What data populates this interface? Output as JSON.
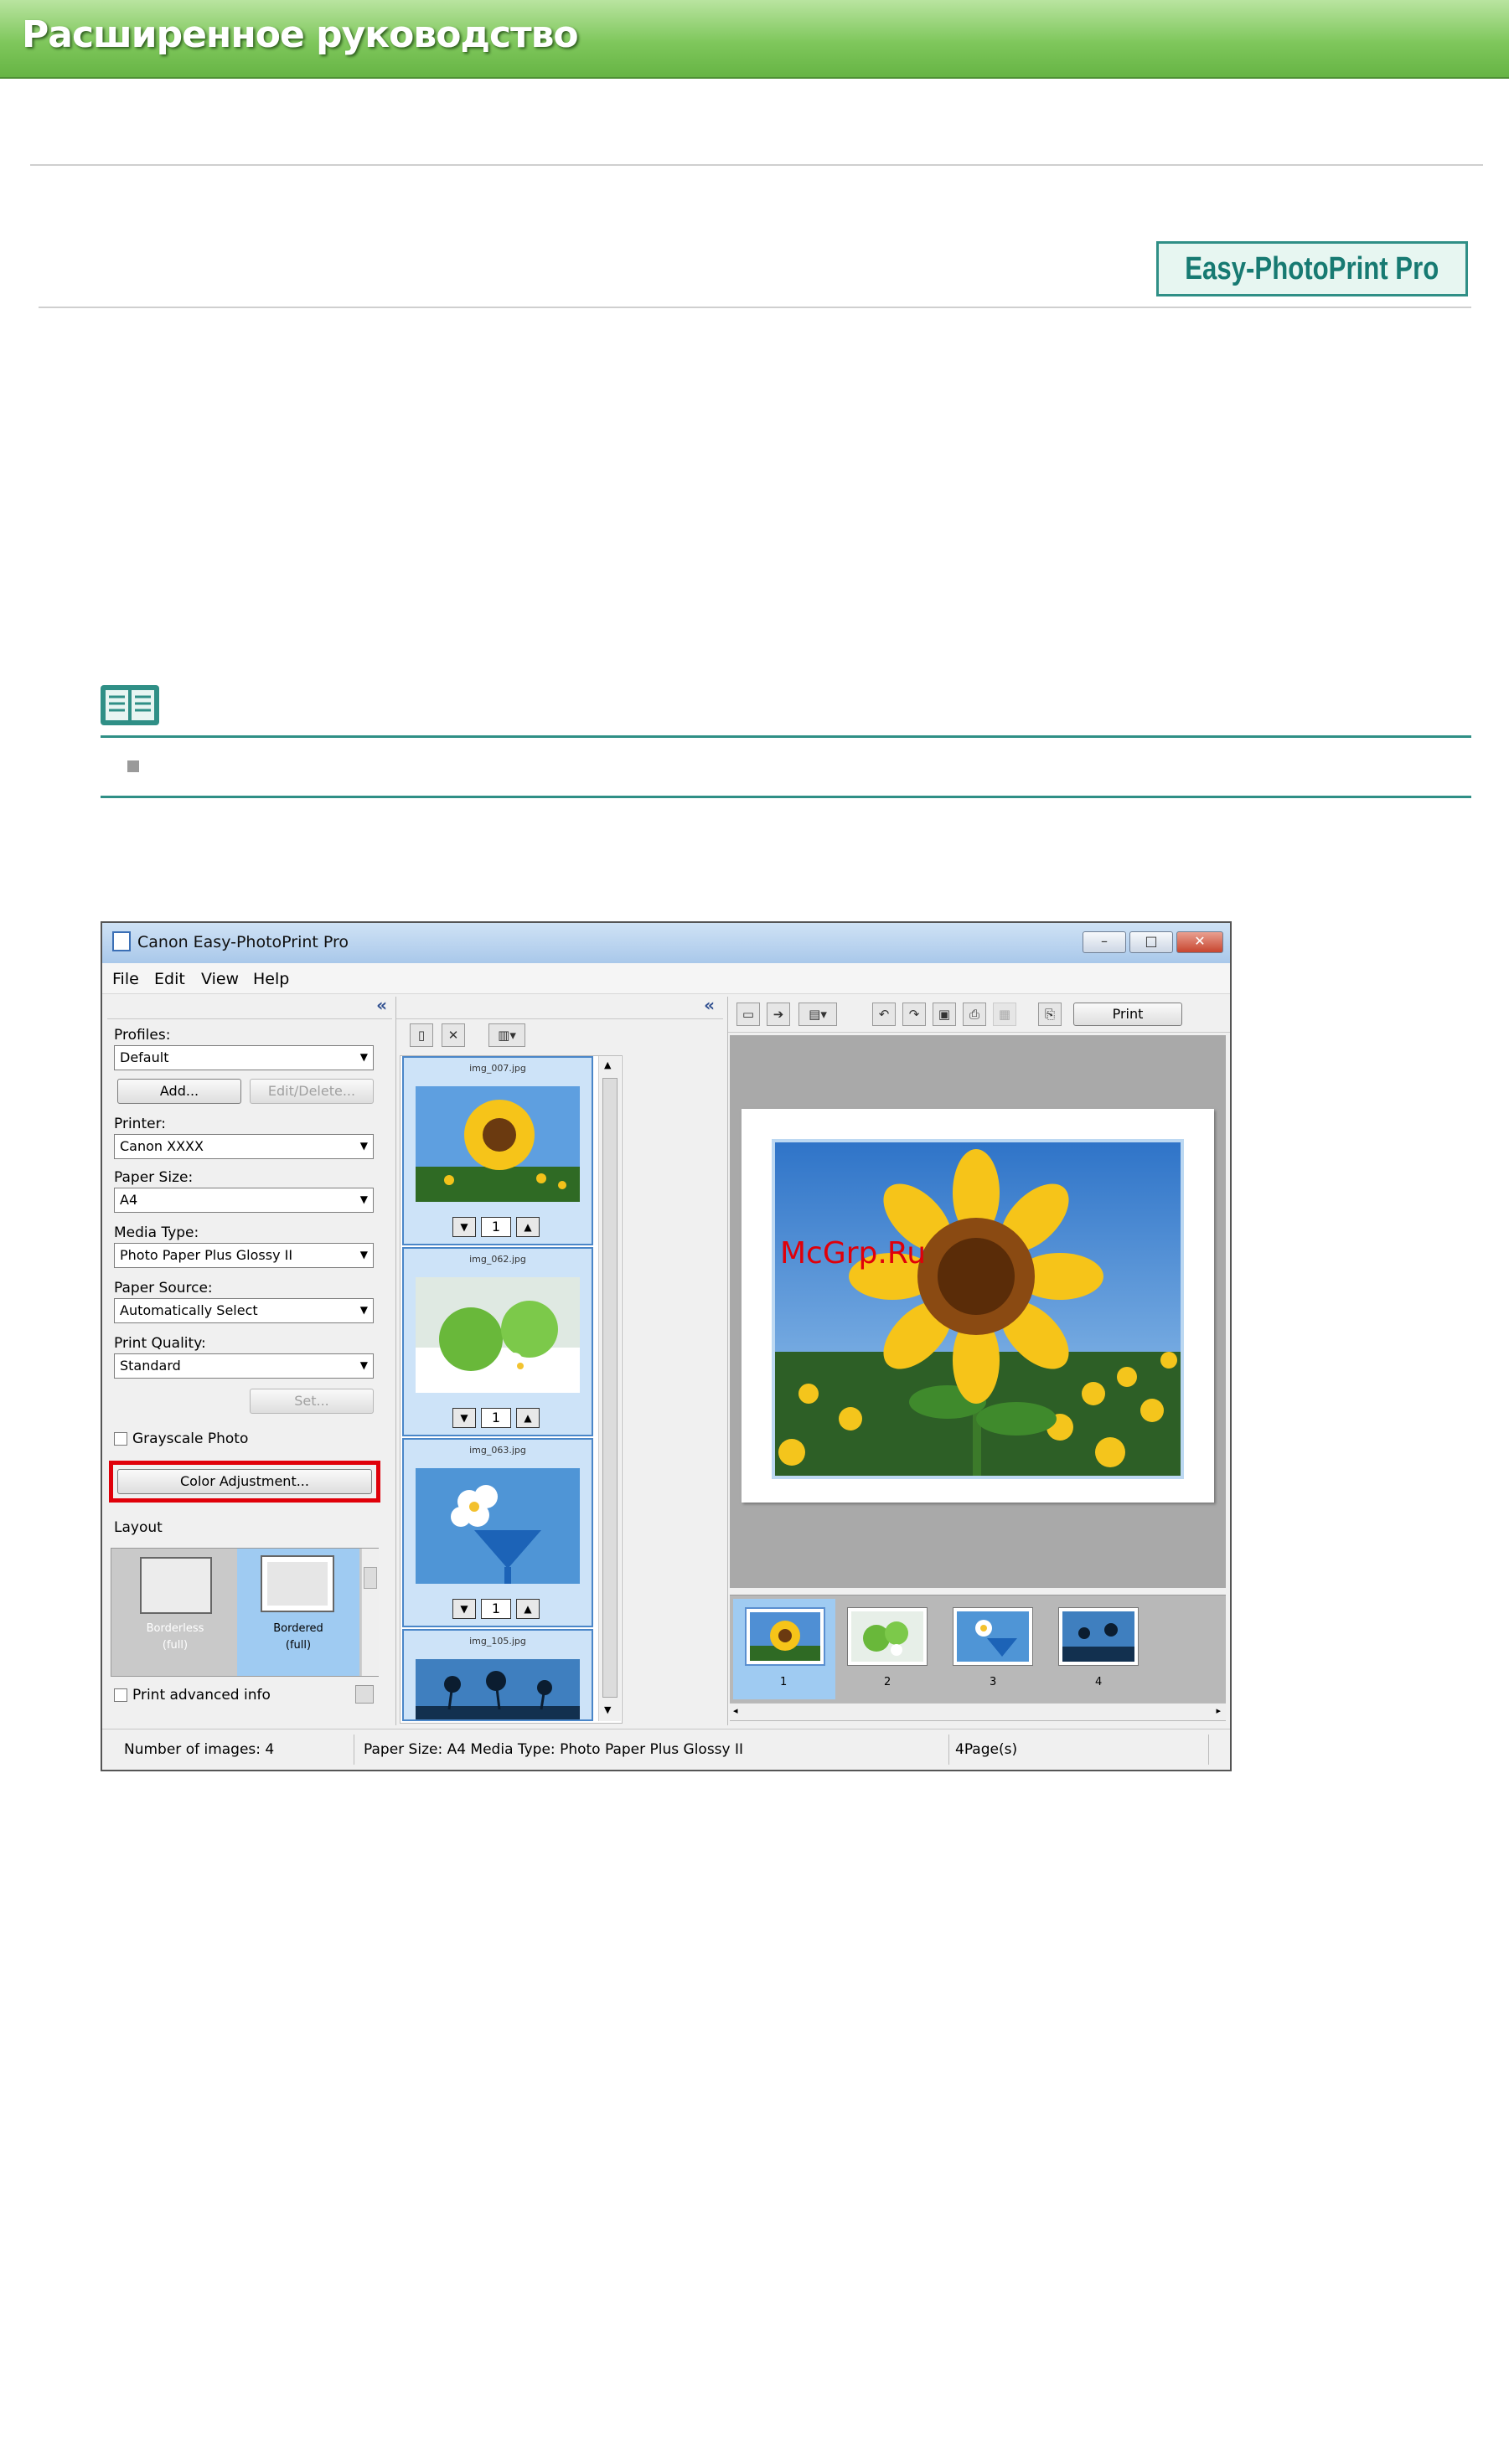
{
  "page": {
    "banner_title": "Расширенное руководство",
    "brand_badge": "Easy-PhotoPrint Pro",
    "watermark": "McGrp.Ru"
  },
  "window": {
    "title": "Canon Easy-PhotoPrint Pro",
    "menu": [
      "File",
      "Edit",
      "View",
      "Help"
    ],
    "controls": {
      "minimize": "–",
      "maximize": "□",
      "close": "✕"
    }
  },
  "left_panel": {
    "collapse": "«",
    "profiles_label": "Profiles:",
    "profiles_value": "Default",
    "add_button": "Add...",
    "edit_delete_button": "Edit/Delete...",
    "printer_label": "Printer:",
    "printer_value": "Canon XXXX",
    "paper_size_label": "Paper Size:",
    "paper_size_value": "A4",
    "media_type_label": "Media Type:",
    "media_type_value": "Photo Paper Plus Glossy II",
    "paper_source_label": "Paper Source:",
    "paper_source_value": "Automatically Select",
    "print_quality_label": "Print Quality:",
    "print_quality_value": "Standard",
    "set_button": "Set...",
    "grayscale_label": "Grayscale Photo",
    "color_adjustment_button": "Color Adjustment...",
    "layout_label": "Layout",
    "layouts": [
      {
        "line1": "Borderless",
        "line2": "(full)"
      },
      {
        "line1": "Bordered",
        "line2": "(full)"
      }
    ],
    "print_advanced_label": "Print advanced info"
  },
  "middle_panel": {
    "collapse": "«",
    "images": [
      {
        "filename": "img_007.jpg",
        "copies": "1"
      },
      {
        "filename": "img_062.jpg",
        "copies": "1"
      },
      {
        "filename": "img_063.jpg",
        "copies": "1"
      },
      {
        "filename": "img_105.jpg",
        "copies": ""
      }
    ]
  },
  "right_panel": {
    "print_button": "Print",
    "pages": [
      "1",
      "2",
      "3",
      "4"
    ]
  },
  "status": {
    "images": "Number of images: 4",
    "paper": "Paper Size: A4  Media Type: Photo Paper Plus Glossy II",
    "pages": "4Page(s)"
  },
  "colors": {
    "banner_green": "#7fc75c",
    "teal": "#2f8f86",
    "highlight_red": "#e0000a",
    "selection_blue": "#cde3f8",
    "preview_gray": "#a9a9a9"
  },
  "icons": [
    "note-book-icon",
    "app-icon",
    "rotate-icon",
    "trim-icon",
    "print-icon"
  ]
}
